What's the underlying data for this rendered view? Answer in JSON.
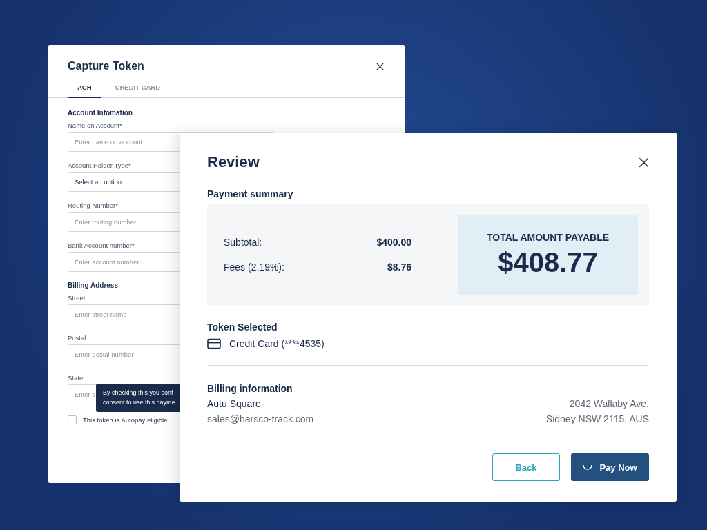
{
  "capture_dialog": {
    "title": "Capture Token",
    "tabs": [
      {
        "label": "ACH",
        "selected": true
      },
      {
        "label": "CREDIT CARD",
        "selected": false
      }
    ],
    "sections": [
      {
        "heading": "Account Infomation",
        "fields": [
          {
            "label": "Name on Account*",
            "placeholder": "Enter name on account",
            "kind": "text"
          },
          {
            "label": "Account Holder Type*",
            "placeholder": "Select an option",
            "kind": "select"
          },
          {
            "label": "Routing Number*",
            "placeholder": "Enter routing number",
            "kind": "text"
          },
          {
            "label": "Bank Account number*",
            "placeholder": "Enter account number",
            "kind": "text"
          }
        ]
      },
      {
        "heading": "Billing Address",
        "fields": [
          {
            "label": "Street",
            "placeholder": "Enter street name",
            "kind": "text"
          },
          {
            "label": "Postal",
            "placeholder": "Enter postal number",
            "kind": "text"
          },
          {
            "label": "State",
            "placeholder": "Enter s",
            "kind": "text"
          }
        ]
      }
    ],
    "tooltip": [
      "By checking this you conf",
      "consent to use this payme"
    ],
    "autopay": {
      "label": "This token is Autopay eligible",
      "checked": false
    }
  },
  "review_dialog": {
    "title": "Review",
    "summary_heading": "Payment summary",
    "summary_rows": [
      {
        "label": "Subtotal:",
        "value": "$400.00"
      },
      {
        "label": "Fees (2.19%):",
        "value": "$8.76"
      }
    ],
    "total_label": "TOTAL AMOUNT PAYABLE",
    "total_value": "$408.77",
    "token_heading": "Token Selected",
    "token": "Credit Card (****4535)",
    "billing_heading": "Billing information",
    "billing_left": [
      "Autu Square",
      "sales@harsco-track.com"
    ],
    "billing_right": [
      "2042 Wallaby Ave.",
      "Sidney NSW 2115, AUS"
    ],
    "buttons": [
      {
        "label": "Back",
        "kind": "secondary"
      },
      {
        "label": "Pay Now",
        "kind": "primary",
        "loading": true
      }
    ]
  }
}
